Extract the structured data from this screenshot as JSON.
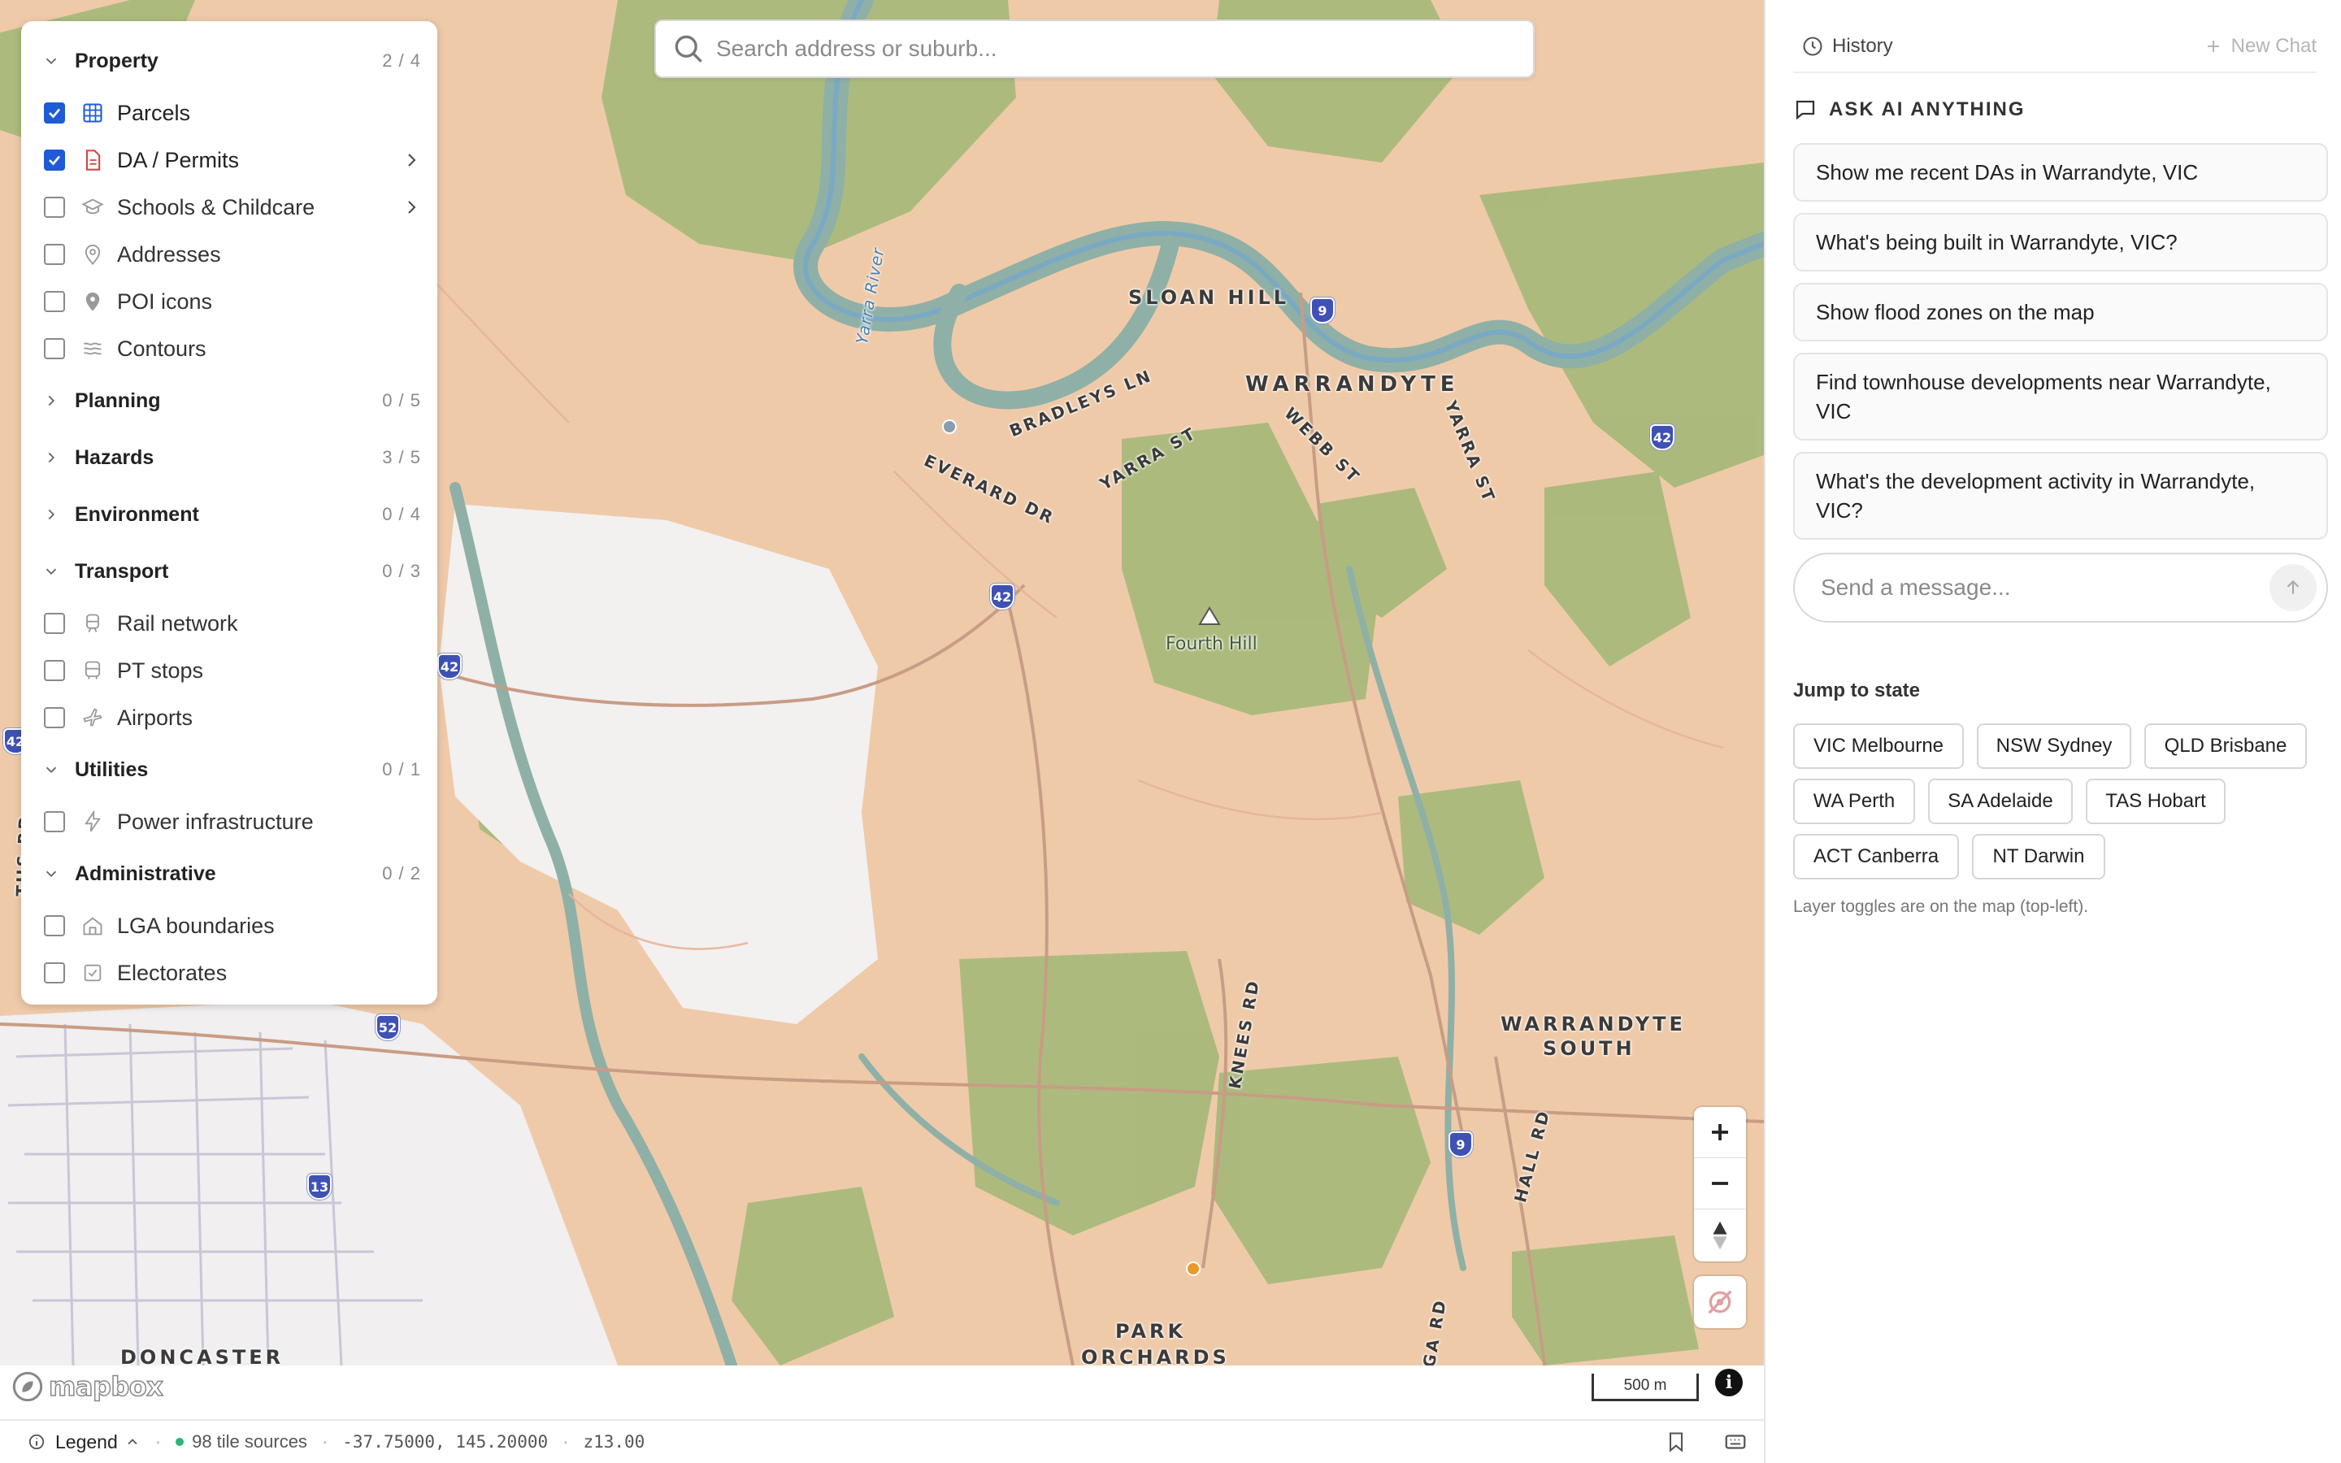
{
  "search": {
    "placeholder": "Search address or suburb..."
  },
  "layers_panel": {
    "groups": [
      {
        "name": "Property",
        "count": "2 / 4",
        "expanded": true,
        "items": [
          {
            "label": "Parcels",
            "checked": true,
            "icon": "grid-icon"
          },
          {
            "label": "DA / Permits",
            "checked": true,
            "icon": "document-icon",
            "has_submenu": true
          },
          {
            "label": "Schools & Childcare",
            "checked": false,
            "icon": "graduation-cap-icon",
            "has_submenu": true
          },
          {
            "label": "Addresses",
            "checked": false,
            "icon": "map-pin-outline-icon"
          },
          {
            "label": "POI icons",
            "checked": false,
            "icon": "map-pin-icon"
          },
          {
            "label": "Contours",
            "checked": false,
            "icon": "waves-icon"
          }
        ]
      },
      {
        "name": "Planning",
        "count": "0 / 5",
        "expanded": false
      },
      {
        "name": "Hazards",
        "count": "3 / 5",
        "expanded": false
      },
      {
        "name": "Environment",
        "count": "0 / 4",
        "expanded": false
      },
      {
        "name": "Transport",
        "count": "0 / 3",
        "expanded": true,
        "items": [
          {
            "label": "Rail network",
            "checked": false,
            "icon": "train-icon"
          },
          {
            "label": "PT stops",
            "checked": false,
            "icon": "bus-icon"
          },
          {
            "label": "Airports",
            "checked": false,
            "icon": "plane-icon"
          }
        ]
      },
      {
        "name": "Utilities",
        "count": "0 / 1",
        "expanded": true,
        "items": [
          {
            "label": "Power infrastructure",
            "checked": false,
            "icon": "lightning-icon"
          }
        ]
      },
      {
        "name": "Administrative",
        "count": "0 / 2",
        "expanded": true,
        "items": [
          {
            "label": "LGA boundaries",
            "checked": false,
            "icon": "building-icon"
          },
          {
            "label": "Electorates",
            "checked": false,
            "icon": "ballot-icon"
          }
        ]
      }
    ]
  },
  "map": {
    "labels": {
      "sloan_hill": "SLOAN HILL",
      "warrandyte": "WARRANDYTE",
      "warrandyte_south_1": "WARRANDYTE",
      "warrandyte_south_2": "SOUTH",
      "park_orchards_1": "PARK",
      "park_orchards_2": "ORCHARDS",
      "doncaster": "DONCASTER",
      "bradleys_ln": "BRADLEYS LN",
      "yarra_st": "YARRA ST",
      "webb_st": "WEBB ST",
      "yarra_st_2": "YARRA ST",
      "everard_dr": "EVERARD DR",
      "knees_rd": "KNEES RD",
      "hall_rd": "HALL RD",
      "ga_rd": "GA RD",
      "yarra_river": "Yarra River",
      "fourth_hill": "Fourth Hill",
      "ths_rd": "THS RD"
    },
    "shields": [
      "9",
      "42",
      "42",
      "42",
      "42",
      "52",
      "13",
      "9"
    ],
    "attribution": "mapbox",
    "scale_label": "500 m",
    "info_label": "i",
    "colors": {
      "land": "#efcaa9",
      "forest": "#a8b97a",
      "water": "#9ab6b0",
      "urban": "#f1efef",
      "shield": "#3f51b5"
    }
  },
  "statusbar": {
    "legend_label": "Legend",
    "tile_sources": "98 tile sources",
    "coords": "-37.75000, 145.20000",
    "zoom": "z13.00"
  },
  "sidebar": {
    "history_label": "History",
    "new_chat_label": "New Chat",
    "ask_title": "ASK AI ANYTHING",
    "suggestions": [
      "Show me recent DAs in Warrandyte, VIC",
      "What's being built in Warrandyte, VIC?",
      "Show flood zones on the map",
      "Find townhouse developments near Warrandyte, VIC",
      "What's the development activity in Warrandyte, VIC?"
    ],
    "message_placeholder": "Send a message...",
    "jump_title": "Jump to state",
    "states": [
      "VIC Melbourne",
      "NSW Sydney",
      "QLD Brisbane",
      "WA Perth",
      "SA Adelaide",
      "TAS Hobart",
      "ACT Canberra",
      "NT Darwin"
    ],
    "hint": "Layer toggles are on the map (top-left)."
  }
}
